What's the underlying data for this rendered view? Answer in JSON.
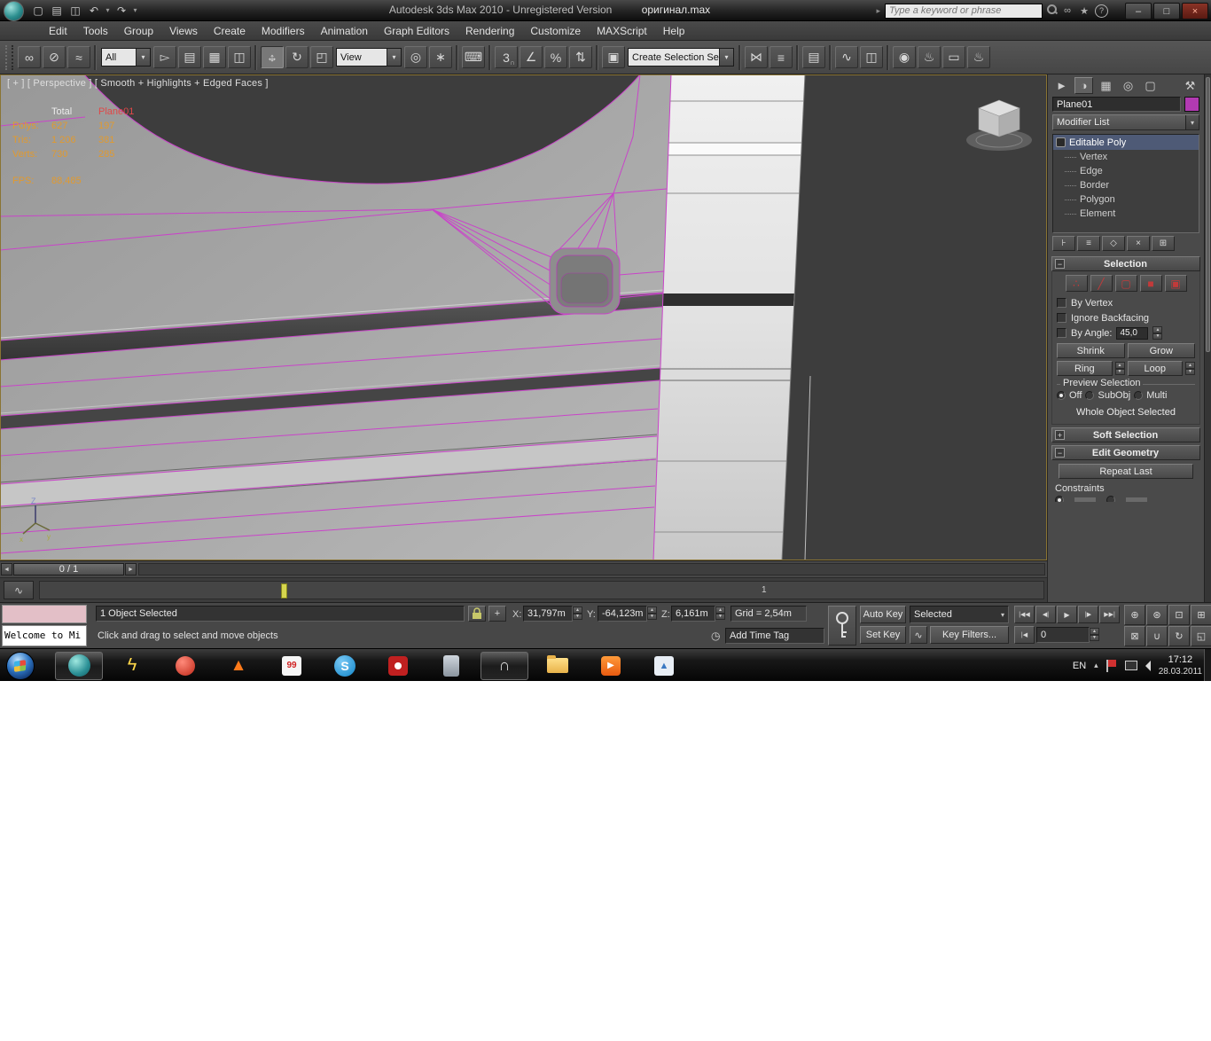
{
  "titlebar": {
    "title_app": "Autodesk 3ds Max  2010",
    "title_unregistered": "- Unregistered Version",
    "title_file": "оригинал.max",
    "search_placeholder": "Type a keyword or phrase"
  },
  "menus": [
    "Edit",
    "Tools",
    "Group",
    "Views",
    "Create",
    "Modifiers",
    "Animation",
    "Graph Editors",
    "Rendering",
    "Customize",
    "MAXScript",
    "Help"
  ],
  "toolbar": {
    "filter_value": "All",
    "ref_coord_value": "View",
    "named_sel_value": "Create Selection Se"
  },
  "viewport": {
    "label": "[ + ] [ Perspective ] [ Smooth + Highlights + Edged Faces ]",
    "stats": {
      "col_total": "Total",
      "col_object": "Plane01",
      "rows": [
        [
          "Polys:",
          "627",
          "197"
        ],
        [
          "Tris:",
          "1 206",
          "381"
        ],
        [
          "Verts:",
          "730",
          "285"
        ]
      ],
      "fps_label": "FPS:",
      "fps_value": "88,485"
    },
    "axis": {
      "x": "x",
      "y": "y",
      "z": "Z"
    },
    "time_slider": "0 / 1",
    "trackbar_frame": "1"
  },
  "command_panel": {
    "object_name": "Plane01",
    "modifier_list": "Modifier List",
    "stack_root": "Editable Poly",
    "stack_children": [
      "Vertex",
      "Edge",
      "Border",
      "Polygon",
      "Element"
    ],
    "selection": {
      "title": "Selection",
      "by_vertex": "By Vertex",
      "ignore_backfacing": "Ignore Backfacing",
      "by_angle": "By Angle:",
      "angle_value": "45,0",
      "shrink": "Shrink",
      "grow": "Grow",
      "ring": "Ring",
      "loop": "Loop",
      "preview_title": "Preview Selection",
      "preview_off": "Off",
      "preview_subobj": "SubObj",
      "preview_multi": "Multi",
      "status": "Whole Object Selected"
    },
    "soft_selection": "Soft Selection",
    "edit_geometry": "Edit Geometry",
    "repeat_last": "Repeat Last",
    "constraints": "Constraints"
  },
  "statusbar": {
    "listener_text": "Welcome to Mi",
    "selection_text": "1 Object Selected",
    "x_label": "X:",
    "x_value": "31,797m",
    "y_label": "Y:",
    "y_value": "-64,123m",
    "z_label": "Z:",
    "z_value": "6,161m",
    "grid_text": "Grid = 2,54m",
    "prompt": "Click and drag to select and move objects",
    "add_time_tag": "Add Time Tag",
    "auto_key": "Auto Key",
    "set_key": "Set Key",
    "key_mode": "Selected",
    "key_filters": "Key Filters...",
    "frame_value": "0"
  },
  "taskbar": {
    "badge_99": "99",
    "skype_letter": "S",
    "tray_lang": "EN",
    "time": "17:12",
    "date": "28.03.2011"
  },
  "icons": {
    "new": "▢",
    "open": "▤",
    "save": "◫",
    "undo": "↶",
    "redo": "↷",
    "caret_down": "▾",
    "caret_right": "▸",
    "binoculars": "∞",
    "star": "★",
    "help": "?",
    "min": "–",
    "max": "□",
    "close": "×",
    "link": "∞",
    "unlink": "⊘",
    "bind_spacewarp": "≈",
    "select_arrow": "▻",
    "select_by_name": "▤",
    "region_rect": "▦",
    "window_crossing": "◫",
    "move_h": "↔",
    "move_v": "↕",
    "rotate": "↻",
    "scale": "◰",
    "pivot_center": "◎",
    "manipulate": "∗",
    "kbd_override": "⌨",
    "snap_3": "3",
    "snap_magnet": "∩",
    "snap_angle": "∠",
    "snap_percent": "%",
    "snap_spinner": "⇅",
    "named_sets": "▣",
    "mirror": "⋈",
    "align": "≡",
    "layers": "▤",
    "curve_editor": "∿",
    "schematic": "◫",
    "material": "◉",
    "render_setup": "♨",
    "render_frame": "▭",
    "render": "♨",
    "tab_create": "►",
    "tab_modify": "◑",
    "tab_hierarchy": "▦",
    "tab_motion": "◎",
    "tab_display": "▢",
    "tab_utilities": "⚒",
    "so_vertex": "∴",
    "so_edge": "╱",
    "so_border": "▢",
    "so_polygon": "■",
    "so_element": "▣",
    "stack_pin": "⊦",
    "stack_result": "≡",
    "stack_unique": "◇",
    "stack_remove": "×",
    "stack_config": "⊞",
    "slider_left": "◄",
    "slider_right": "►",
    "go_start": "|◀◀",
    "prev_frame": "◀|",
    "play": "▶",
    "next_frame": "|▶",
    "go_end": "▶▶|",
    "prev_key": "|◀",
    "nav": [
      "⊕",
      "⊛",
      "⊡",
      "⊞",
      "⊠",
      "∪",
      "↻",
      "◱"
    ],
    "clock": "◷",
    "bolt": "ϟ",
    "flame": "▲",
    "magnet": "∩",
    "play_media": "▶",
    "photo": "▲",
    "tray_up": "▴"
  }
}
